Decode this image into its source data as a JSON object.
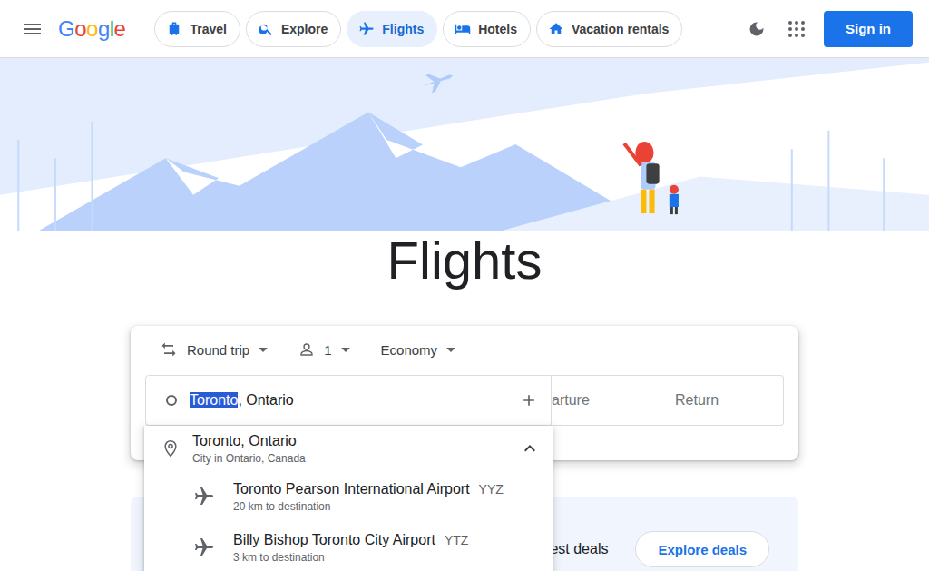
{
  "logo": [
    {
      "char": "G",
      "color": "#4285f4"
    },
    {
      "char": "o",
      "color": "#ea4335"
    },
    {
      "char": "o",
      "color": "#fbbc05"
    },
    {
      "char": "g",
      "color": "#4285f4"
    },
    {
      "char": "l",
      "color": "#34a853"
    },
    {
      "char": "e",
      "color": "#ea4335"
    }
  ],
  "nav_tabs": [
    {
      "label": "Travel",
      "selected": false
    },
    {
      "label": "Explore",
      "selected": false
    },
    {
      "label": "Flights",
      "selected": true
    },
    {
      "label": "Hotels",
      "selected": false
    },
    {
      "label": "Vacation rentals",
      "selected": false
    }
  ],
  "sign_in": "Sign in",
  "title": "Flights",
  "search": {
    "trip_type": "Round trip",
    "passengers": "1",
    "cabin": "Economy",
    "origin": {
      "highlighted": "Toronto",
      "rest": ", Ontario"
    },
    "departure_placeholder": "arture",
    "return_placeholder": "Return"
  },
  "suggestions": {
    "expanded": true,
    "city": {
      "name": "Toronto, Ontario",
      "subtitle": "City in Ontario, Canada"
    },
    "airports": [
      {
        "name": "Toronto Pearson International Airport",
        "code": "YYZ",
        "distance": "20 km to destination"
      },
      {
        "name": "Billy Bishop Toronto City Airport",
        "code": "YTZ",
        "distance": "3 km to destination"
      }
    ]
  },
  "deals": {
    "text": "best deals",
    "button": "Explore deals"
  }
}
